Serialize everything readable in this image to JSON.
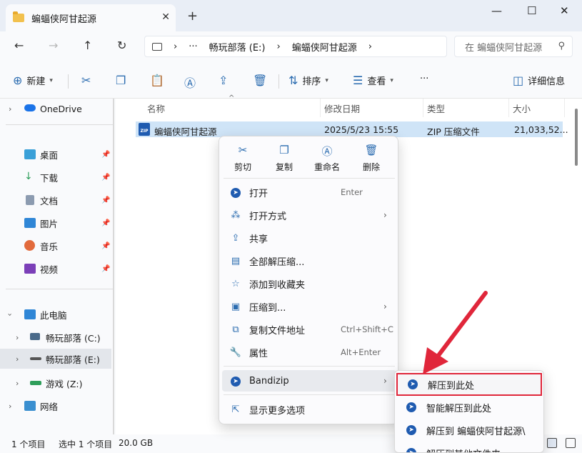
{
  "window": {
    "tab_title": "蝙蝠侠阿甘起源",
    "tab_close": "✕",
    "new_tab": "+",
    "minimize": "—",
    "maximize": "☐",
    "close": "✕"
  },
  "nav": {
    "back": "←",
    "forward": "→",
    "up": "↑",
    "refresh": "↻",
    "breadcrumb": [
      "›",
      "···",
      "畅玩部落 (E:)",
      "›",
      "蝙蝠侠阿甘起源",
      "›"
    ],
    "search_placeholder": "在 蝙蝠侠阿甘起源"
  },
  "commands": {
    "new_label": "新建",
    "sort_label": "排序",
    "view_label": "查看",
    "more": "···",
    "details_label": "详细信息"
  },
  "sidebar": {
    "onedrive": "OneDrive",
    "desktop": "桌面",
    "downloads": "下载",
    "documents": "文档",
    "pictures": "图片",
    "music": "音乐",
    "videos": "视频",
    "this_pc": "此电脑",
    "drive_c": "畅玩部落 (C:)",
    "drive_e": "畅玩部落 (E:)",
    "drive_z": "游戏 (Z:)",
    "network": "网络"
  },
  "columns": {
    "name": "名称",
    "modified": "修改日期",
    "type": "类型",
    "size": "大小"
  },
  "file": {
    "icon_text": "ZIP",
    "name": "蝙蝠侠阿甘起源",
    "modified": "2025/5/23 15:55",
    "type": "ZIP 压缩文件",
    "size": "21,033,52..."
  },
  "context_menu": {
    "quick_actions": [
      "剪切",
      "复制",
      "重命名",
      "删除"
    ],
    "items": {
      "open": "打开",
      "open_shortcut": "Enter",
      "open_with": "打开方式",
      "share": "共享",
      "extract_all": "全部解压缩...",
      "add_favorites": "添加到收藏夹",
      "compress_to": "压缩到...",
      "copy_path": "复制文件地址",
      "copy_path_shortcut": "Ctrl+Shift+C",
      "properties": "属性",
      "properties_shortcut": "Alt+Enter",
      "bandizip": "Bandizip",
      "show_more": "显示更多选项"
    }
  },
  "submenu": {
    "items": [
      "解压到此处",
      "智能解压到此处",
      "解压到 蝙蝠侠阿甘起源\\",
      "解压到其他文件夹"
    ]
  },
  "status": {
    "count": "1 个项目",
    "selected": "选中 1 个项目",
    "size": "20.0 GB"
  },
  "colors": {
    "highlight_border": "#e0263a",
    "arrow": "#e0263a",
    "selection": "#cfe4f7",
    "accent": "#2b6cb0"
  }
}
